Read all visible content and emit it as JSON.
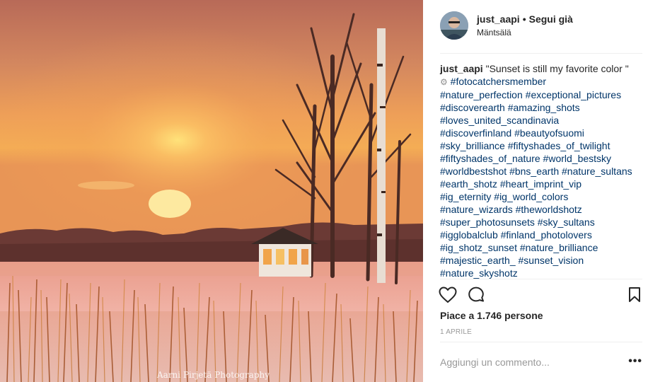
{
  "post": {
    "username": "just_aapi",
    "separator": "•",
    "follow_label": "Segui già",
    "location": "Mäntsälä"
  },
  "caption": {
    "username": "just_aapi",
    "text": "\"Sunset is still my favorite color \"",
    "gear": "⚙",
    "hashtags": [
      "#fotocatchersmember",
      "#nature_perfection",
      "#exceptional_pictures",
      "#discoverearth",
      "#amazing_shots",
      "#loves_united_scandinavia",
      "#discoverfinland",
      "#beautyofsuomi",
      "#sky_brilliance",
      "#fiftyshades_of_twilight",
      "#fiftyshades_of_nature",
      "#world_bestsky",
      "#worldbestshot",
      "#bns_earth",
      "#nature_sultans",
      "#earth_shotz",
      "#heart_imprint_vip",
      "#ig_eternity",
      "#ig_world_colors",
      "#nature_wizards",
      "#theworldshotz",
      "#super_photosunsets",
      "#sky_sultans",
      "#igglobalclub",
      "#finland_photolovers",
      "#ig_shotz_sunset",
      "#nature_brilliance",
      "#majestic_earth_",
      "#sunset_vision",
      "#nature_skyshotz"
    ]
  },
  "photo": {
    "watermark": "Aarni Pirjetä Photography"
  },
  "engagement": {
    "likes": "Piace a 1.746 persone",
    "date": "1 APRILE"
  },
  "comment": {
    "placeholder": "Aggiungi un commento...",
    "more": "•••"
  }
}
